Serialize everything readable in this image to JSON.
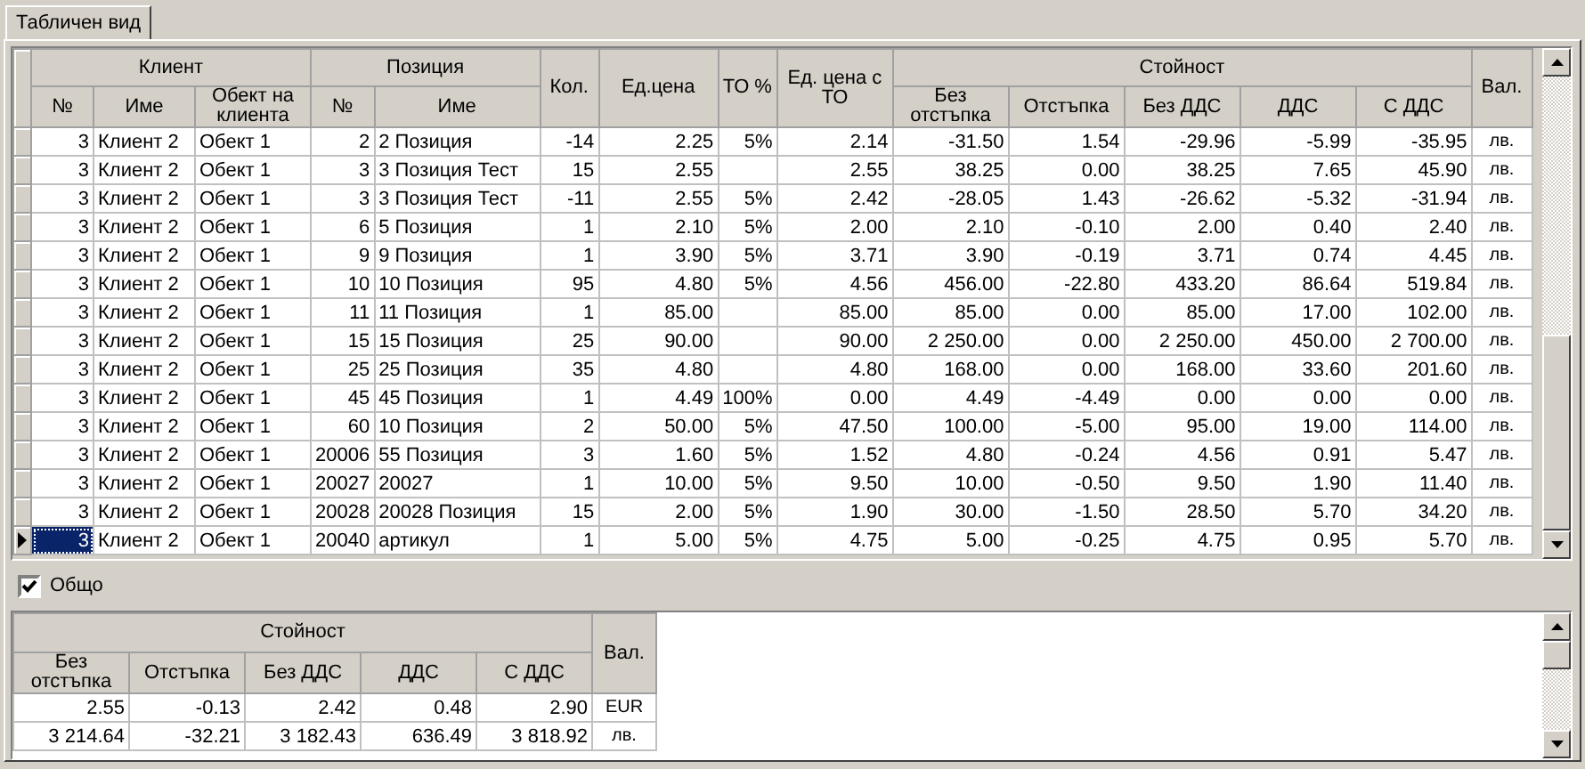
{
  "tabs": [
    {
      "label": "Табличен вид",
      "selected": true
    }
  ],
  "table": {
    "groups": [
      {
        "label": "Клиент",
        "columns": [
          {
            "label": "№"
          },
          {
            "label": "Име"
          },
          {
            "label": "Обект на клиента"
          }
        ]
      },
      {
        "label": "Позиция",
        "columns": [
          {
            "label": "№"
          },
          {
            "label": "Име"
          }
        ]
      },
      {
        "label": "Кол."
      },
      {
        "label": "Ед.цена"
      },
      {
        "label": "ТО %"
      },
      {
        "label": "Ед. цена с ТО"
      },
      {
        "label": "Стойност",
        "columns": [
          {
            "label": "Без отстъпка"
          },
          {
            "label": "Отстъпка"
          },
          {
            "label": "Без ДДС"
          },
          {
            "label": "ДДС"
          },
          {
            "label": "С ДДС"
          }
        ]
      },
      {
        "label": "Вал."
      }
    ],
    "rows": [
      {
        "selected": false,
        "cells": [
          "3",
          "Клиент 2",
          "Обект 1",
          "2",
          "2 Позиция",
          "-14",
          "2.25",
          "5%",
          "2.14",
          "-31.50",
          "1.54",
          "-29.96",
          "-5.99",
          "-35.95",
          "лв."
        ]
      },
      {
        "selected": false,
        "cells": [
          "3",
          "Клиент 2",
          "Обект 1",
          "3",
          "3 Позиция Тест",
          "15",
          "2.55",
          null,
          "2.55",
          "38.25",
          "0.00",
          "38.25",
          "7.65",
          "45.90",
          "лв."
        ]
      },
      {
        "selected": false,
        "cells": [
          "3",
          "Клиент 2",
          "Обект 1",
          "3",
          "3 Позиция Тест",
          "-11",
          "2.55",
          "5%",
          "2.42",
          "-28.05",
          "1.43",
          "-26.62",
          "-5.32",
          "-31.94",
          "лв."
        ]
      },
      {
        "selected": false,
        "cells": [
          "3",
          "Клиент 2",
          "Обект 1",
          "6",
          "5 Позиция",
          "1",
          "2.10",
          "5%",
          "2.00",
          "2.10",
          "-0.10",
          "2.00",
          "0.40",
          "2.40",
          "лв."
        ]
      },
      {
        "selected": false,
        "cells": [
          "3",
          "Клиент 2",
          "Обект 1",
          "9",
          "9 Позиция",
          "1",
          "3.90",
          "5%",
          "3.71",
          "3.90",
          "-0.19",
          "3.71",
          "0.74",
          "4.45",
          "лв."
        ]
      },
      {
        "selected": false,
        "cells": [
          "3",
          "Клиент 2",
          "Обект 1",
          "10",
          "10 Позиция",
          "95",
          "4.80",
          "5%",
          "4.56",
          "456.00",
          "-22.80",
          "433.20",
          "86.64",
          "519.84",
          "лв."
        ]
      },
      {
        "selected": false,
        "cells": [
          "3",
          "Клиент 2",
          "Обект 1",
          "11",
          "11 Позиция",
          "1",
          "85.00",
          null,
          "85.00",
          "85.00",
          "0.00",
          "85.00",
          "17.00",
          "102.00",
          "лв."
        ]
      },
      {
        "selected": false,
        "cells": [
          "3",
          "Клиент 2",
          "Обект 1",
          "15",
          "15 Позиция",
          "25",
          "90.00",
          null,
          "90.00",
          "2 250.00",
          "0.00",
          "2 250.00",
          "450.00",
          "2 700.00",
          "лв."
        ]
      },
      {
        "selected": false,
        "cells": [
          "3",
          "Клиент 2",
          "Обект 1",
          "25",
          "25 Позиция",
          "35",
          "4.80",
          null,
          "4.80",
          "168.00",
          "0.00",
          "168.00",
          "33.60",
          "201.60",
          "лв."
        ]
      },
      {
        "selected": false,
        "cells": [
          "3",
          "Клиент 2",
          "Обект 1",
          "45",
          "45 Позиция",
          "1",
          "4.49",
          "100%",
          "0.00",
          "4.49",
          "-4.49",
          "0.00",
          "0.00",
          "0.00",
          "лв."
        ]
      },
      {
        "selected": false,
        "cells": [
          "3",
          "Клиент 2",
          "Обект 1",
          "60",
          "10 Позиция",
          "2",
          "50.00",
          "5%",
          "47.50",
          "100.00",
          "-5.00",
          "95.00",
          "19.00",
          "114.00",
          "лв."
        ]
      },
      {
        "selected": false,
        "cells": [
          "3",
          "Клиент 2",
          "Обект 1",
          "20006",
          "55 Позиция",
          "3",
          "1.60",
          "5%",
          "1.52",
          "4.80",
          "-0.24",
          "4.56",
          "0.91",
          "5.47",
          "лв."
        ]
      },
      {
        "selected": false,
        "cells": [
          "3",
          "Клиент 2",
          "Обект 1",
          "20027",
          "20027",
          "1",
          "10.00",
          "5%",
          "9.50",
          "10.00",
          "-0.50",
          "9.50",
          "1.90",
          "11.40",
          "лв."
        ]
      },
      {
        "selected": false,
        "cells": [
          "3",
          "Клиент 2",
          "Обект 1",
          "20028",
          "20028 Позиция",
          "15",
          "2.00",
          "5%",
          "1.90",
          "30.00",
          "-1.50",
          "28.50",
          "5.70",
          "34.20",
          "лв."
        ]
      },
      {
        "selected": true,
        "cells": [
          "3",
          "Клиент 2",
          "Обект 1",
          "20040",
          "артикул",
          "1",
          "5.00",
          "5%",
          "4.75",
          "5.00",
          "-0.25",
          "4.75",
          "0.95",
          "5.70",
          "лв."
        ]
      }
    ]
  },
  "total_checkbox": {
    "label": "Общо",
    "checked": true
  },
  "summary": {
    "groups": [
      {
        "label": "Стойност",
        "columns": [
          {
            "label": "Без отстъпка"
          },
          {
            "label": "Отстъпка"
          },
          {
            "label": "Без ДДС"
          },
          {
            "label": "ДДС"
          },
          {
            "label": "С ДДС"
          }
        ]
      },
      {
        "label": "Вал."
      }
    ],
    "rows": [
      {
        "cells": [
          "2.55",
          "-0.13",
          "2.42",
          "0.48",
          "2.90",
          "EUR"
        ]
      },
      {
        "cells": [
          "3 214.64",
          "-32.21",
          "3 182.43",
          "636.49",
          "3 818.92",
          "лв."
        ]
      }
    ]
  }
}
